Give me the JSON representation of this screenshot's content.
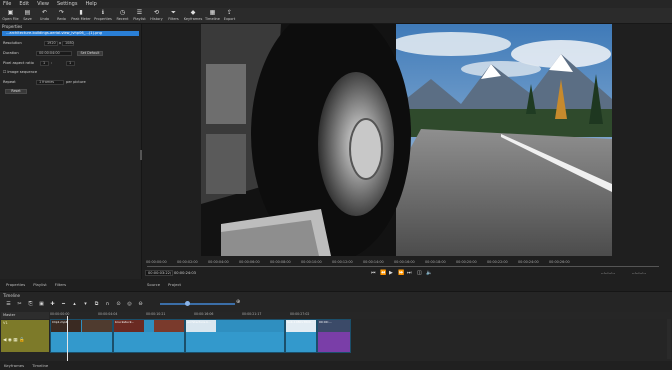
{
  "menu": [
    "File",
    "Edit",
    "View",
    "Settings",
    "Help"
  ],
  "toolbar": [
    {
      "icon": "folder-open-icon",
      "glyph": "▣",
      "label": "Open File"
    },
    {
      "icon": "save-icon",
      "glyph": "▤",
      "label": "Save"
    },
    {
      "icon": "undo-icon",
      "glyph": "↶",
      "label": "Undo"
    },
    {
      "icon": "redo-icon",
      "glyph": "↷",
      "label": "Redo"
    },
    {
      "icon": "peak-meter-icon",
      "glyph": "▮",
      "label": "Peak Meter"
    },
    {
      "icon": "properties-icon",
      "glyph": "ℹ",
      "label": "Properties"
    },
    {
      "icon": "recent-icon",
      "glyph": "◷",
      "label": "Recent"
    },
    {
      "icon": "playlist-icon",
      "glyph": "☰",
      "label": "Playlist"
    },
    {
      "icon": "history-icon",
      "glyph": "⟲",
      "label": "History"
    },
    {
      "icon": "filters-icon",
      "glyph": "⏷",
      "label": "Filters"
    },
    {
      "icon": "keyframes-icon",
      "glyph": "◆",
      "label": "Keyframes"
    },
    {
      "icon": "timeline-icon",
      "glyph": "▦",
      "label": "Timeline"
    },
    {
      "icon": "export-icon",
      "glyph": "⇪",
      "label": "Export"
    }
  ],
  "properties": {
    "title": "Properties",
    "file_name": "...architecture-buildings-aerial-view_lvhp06_...(1).png",
    "resolution_label": "Resolution",
    "res_w": "1920",
    "res_x": "x",
    "res_h": "1080",
    "duration_label": "Duration",
    "duration_value": "00:00:04:00",
    "set_default": "Set Default",
    "par_label": "Pixel aspect ratio",
    "par_a": "1",
    "par_colon": ":",
    "par_b": "1",
    "image_sequence": "Image sequence",
    "repeat_label": "Repeat",
    "repeat_value": "1 frames",
    "per_picture": "per picture",
    "reset": "Reset"
  },
  "ruler": [
    "00:00:00:00",
    "00:00:02:00",
    "00:00:04:00",
    "00:00:06:00",
    "00:00:08:00",
    "00:00:10:00",
    "00:00:12:00",
    "00:00:14:00",
    "00:00:16:00",
    "00:00:18:00",
    "00:00:20:00",
    "00:00:22:00",
    "00:00:24:00",
    "00:00:26:00"
  ],
  "transport": {
    "current": "00:00:03:22",
    "slash": "/",
    "total": "00:00:24:03",
    "time_left": "--:--:--:--",
    "time_right": "--:--:--:--"
  },
  "left_tabs": [
    "Properties",
    "Playlist",
    "Filters"
  ],
  "viewer_tabs": [
    "Source",
    "Project"
  ],
  "timeline": {
    "title": "Timeline",
    "master": "Master",
    "track": "V1",
    "ruler": [
      "00:00:00:00",
      "00:00:04:04",
      "00:00:10:21",
      "00:00:16:06",
      "00:00:21:17",
      "00:00:27:02"
    ],
    "clips": [
      "Clip1.mp4",
      "bruckstuck...",
      "architecture-b...",
      "Sub-1080x3800...",
      "00:00:..."
    ]
  },
  "bottom_tabs": [
    "Keyframes",
    "Timeline"
  ]
}
